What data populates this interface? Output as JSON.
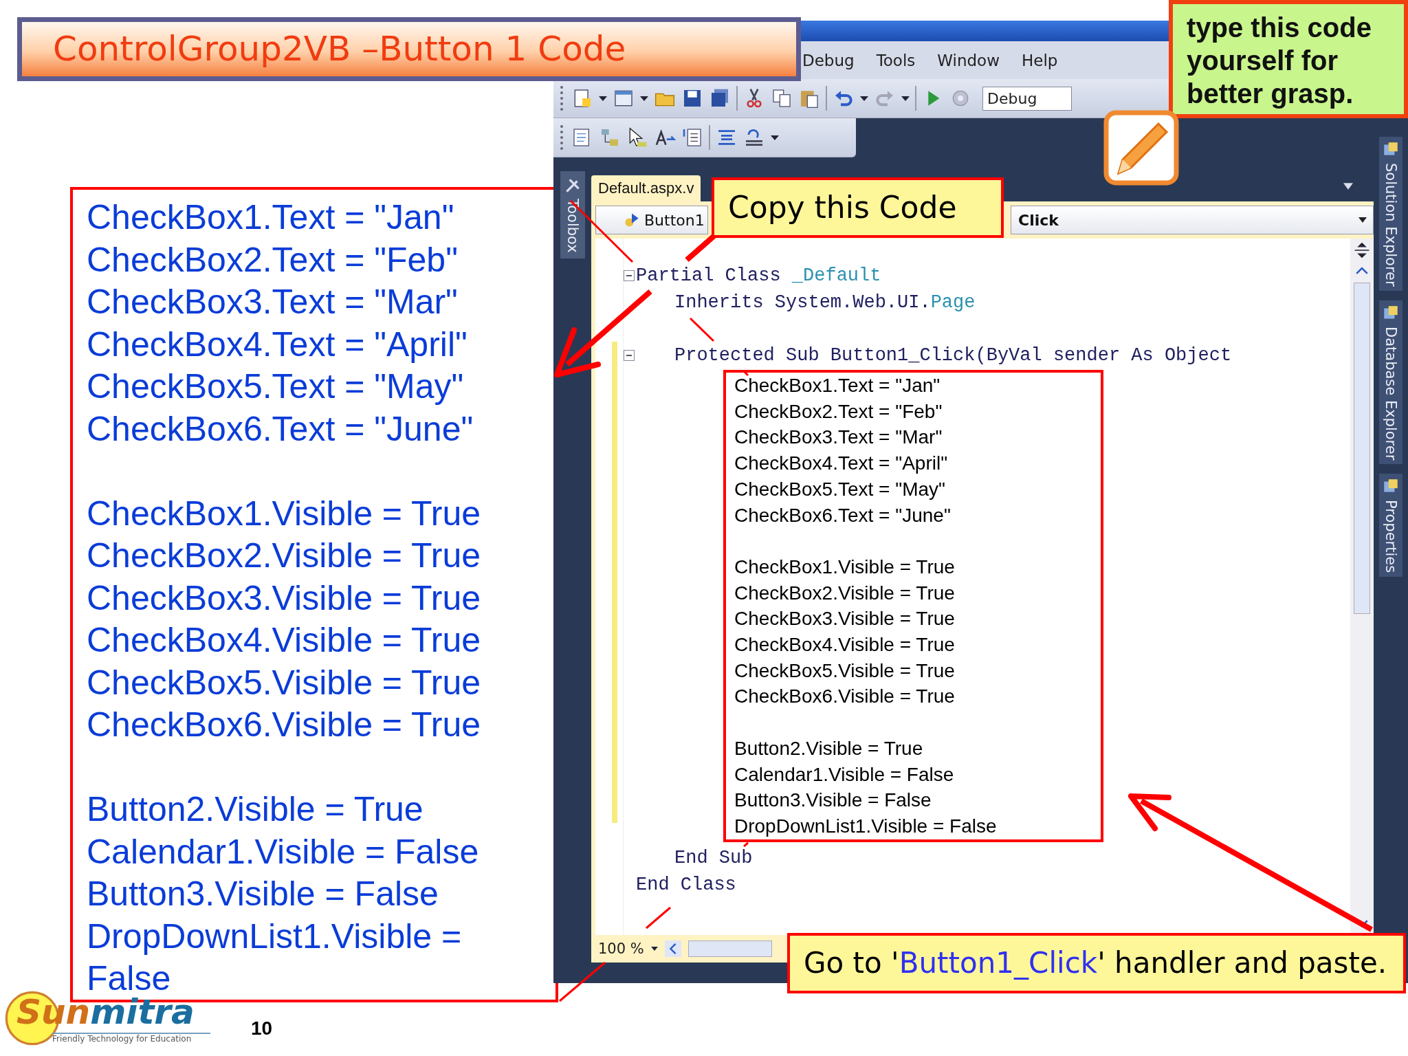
{
  "slide_title": "ControlGroup2VB –Button 1 Code",
  "code_listing": {
    "groups": [
      [
        "CheckBox1.Text = \"Jan\"",
        "CheckBox2.Text = \"Feb\"",
        "CheckBox3.Text = \"Mar\"",
        "CheckBox4.Text = \"April\"",
        "CheckBox5.Text = \"May\"",
        "CheckBox6.Text = \"June\""
      ],
      [
        "CheckBox1.Visible = True",
        "CheckBox2.Visible = True",
        "CheckBox3.Visible = True",
        "CheckBox4.Visible = True",
        "CheckBox5.Visible = True",
        "CheckBox6.Visible = True"
      ],
      [
        "Button2.Visible = True",
        "Calendar1.Visible = False",
        "Button3.Visible = False",
        "DropDownList1.Visible = False"
      ]
    ]
  },
  "ide": {
    "menu": [
      "Debug",
      "Tools",
      "Window",
      "Help"
    ],
    "config": "Debug",
    "tabs": [
      {
        "label": "Default.aspx.v",
        "selected": true
      }
    ],
    "toolbox_label": "Toolbox",
    "class_dropdown": "Button1",
    "method_dropdown": "Click",
    "code": [
      {
        "kind": "class_open",
        "text": "Partial Class ",
        "name": "_Default"
      },
      {
        "kind": "inherits",
        "text": "Inherits System.Web.UI.",
        "name": "Page"
      },
      {
        "kind": "sub_open",
        "text": "Protected Sub Button1_Click(ByVal sender As Object"
      },
      {
        "kind": "paste"
      },
      {
        "kind": "sub_close",
        "text": "End Sub"
      },
      {
        "kind": "class_close",
        "text": "End Class"
      }
    ],
    "pasted_code": {
      "groups": [
        [
          "CheckBox1.Text = \"Jan\"",
          "CheckBox2.Text = \"Feb\"",
          "CheckBox3.Text = \"Mar\"",
          "CheckBox4.Text = \"April\"",
          "CheckBox5.Text = \"May\"",
          "CheckBox6.Text = \"June\""
        ],
        [
          "CheckBox1.Visible = True",
          "CheckBox2.Visible = True",
          "CheckBox3.Visible = True",
          "CheckBox4.Visible = True",
          "CheckBox5.Visible = True",
          "CheckBox6.Visible = True"
        ],
        [
          "Button2.Visible = True",
          "Calendar1.Visible = False",
          "Button3.Visible = False",
          "DropDownList1.Visible = False"
        ]
      ]
    },
    "zoom": "100 %",
    "side_tabs": [
      "Solution Explorer",
      "Database Explorer",
      "Properties"
    ]
  },
  "copy_callout": "Copy this Code",
  "tip_callout": "type this code yourself for better grasp.",
  "paste_callout": {
    "before": "Go to '",
    "highlight": "Button1_Click",
    "after": "' handler and paste."
  },
  "logo": {
    "first": "Sun",
    "second": "mitra",
    "tagline": "Friendly Technology for Education"
  },
  "page_number": "10"
}
